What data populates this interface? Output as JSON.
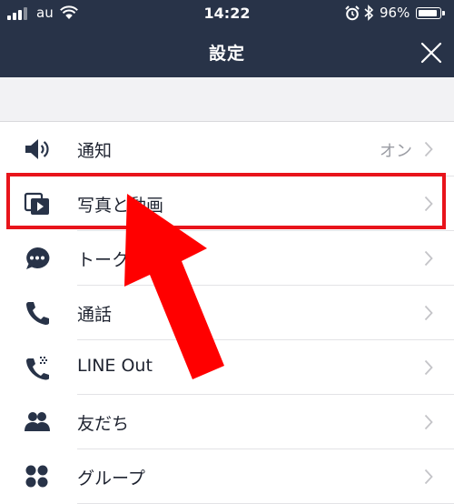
{
  "status_bar": {
    "carrier": "au",
    "time": "14:22",
    "battery": "96%",
    "battery_level": 0.96
  },
  "nav": {
    "title": "設定",
    "close_icon": "close-icon"
  },
  "settings": [
    {
      "label": "通知",
      "value": "オン",
      "icon": "speaker-icon"
    },
    {
      "label": "写真と動画",
      "value": "",
      "icon": "media-icon"
    },
    {
      "label": "トーク",
      "value": "",
      "icon": "chat-bubble-icon"
    },
    {
      "label": "通話",
      "value": "",
      "icon": "phone-icon"
    },
    {
      "label": "LINE Out",
      "value": "",
      "icon": "phone-out-icon"
    },
    {
      "label": "友だち",
      "value": "",
      "icon": "friends-icon"
    },
    {
      "label": "グループ",
      "value": "",
      "icon": "group-icon"
    }
  ],
  "annotation": {
    "highlight_color": "#e8141b",
    "arrow_color": "#ff0000"
  },
  "colors": {
    "header_bg": "#283348",
    "icon": "#283348",
    "chevron": "#c4c4c8"
  }
}
